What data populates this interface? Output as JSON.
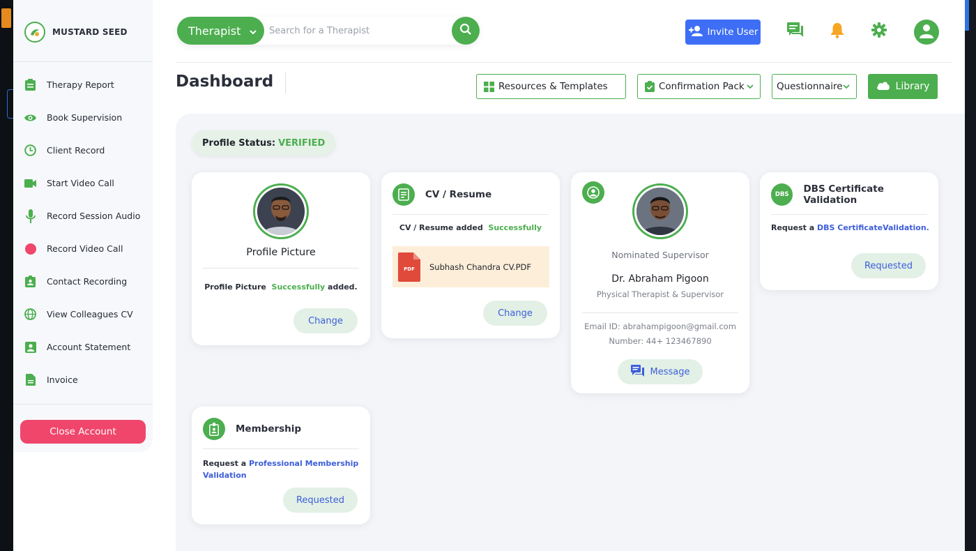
{
  "brand": {
    "name": "MUSTARD SEED"
  },
  "sidebar": {
    "items": [
      {
        "label": "Therapy Report",
        "icon": "clipboard-icon"
      },
      {
        "label": "Book Supervision",
        "icon": "eye-icon"
      },
      {
        "label": "Client Record",
        "icon": "clock-icon"
      },
      {
        "label": "Start Video Call",
        "icon": "video-camera-icon"
      },
      {
        "label": "Record Session Audio",
        "icon": "microphone-icon"
      },
      {
        "label": "Record Video Call",
        "icon": "record-dot-icon"
      },
      {
        "label": "Contact Recording",
        "icon": "contact-badge-icon"
      },
      {
        "label": "View Colleagues CV",
        "icon": "globe-icon"
      },
      {
        "label": "Account Statement",
        "icon": "account-icon"
      },
      {
        "label": "Invoice",
        "icon": "document-icon"
      }
    ],
    "close_account": "Close Account"
  },
  "search": {
    "role": "Therapist",
    "placeholder": "Search for a Therapist"
  },
  "header": {
    "invite_user": "Invite User",
    "page_title": "Dashboard",
    "resources": "Resources & Templates",
    "confirmation_pack": "Confirmation Pack",
    "questionnaire": "Questionnaire",
    "library": "Library"
  },
  "profile_status": {
    "label": "Profile Status:",
    "value": "VERIFIED"
  },
  "cards": {
    "profile_picture": {
      "title": "Profile Picture",
      "msg_prefix": "Profile Picture",
      "msg_status": "Successfully",
      "msg_suffix": "added.",
      "button": "Change"
    },
    "cv": {
      "title": "CV / Resume",
      "msg_prefix": "CV / Resume added",
      "msg_status": "Successfully",
      "file_name": "Subhash Chandra CV.PDF",
      "file_type": "PDF",
      "button": "Change"
    },
    "supervisor": {
      "role": "Nominated Supervisor",
      "name": "Dr. Abraham Pigoon",
      "title": "Physical Therapist & Supervisor",
      "email": "Email ID: abrahampigoon@gmail.com",
      "number": "Number: 44+ 123467890",
      "button": "Message"
    },
    "dbs": {
      "title": "DBS Certificate Validation",
      "icon_text": "DBS",
      "msg_prefix": "Request a",
      "msg_link": "DBS CertificateValidation.",
      "button": "Requested"
    },
    "membership": {
      "title": "Membership",
      "msg_prefix": "Request a",
      "msg_link": "Professional Membership Validation",
      "button": "Requested"
    }
  },
  "colors": {
    "brand_green": "#4cae4f",
    "accent_blue": "#3d6ef5",
    "danger": "#f0466b",
    "link": "#3d5ed8"
  }
}
